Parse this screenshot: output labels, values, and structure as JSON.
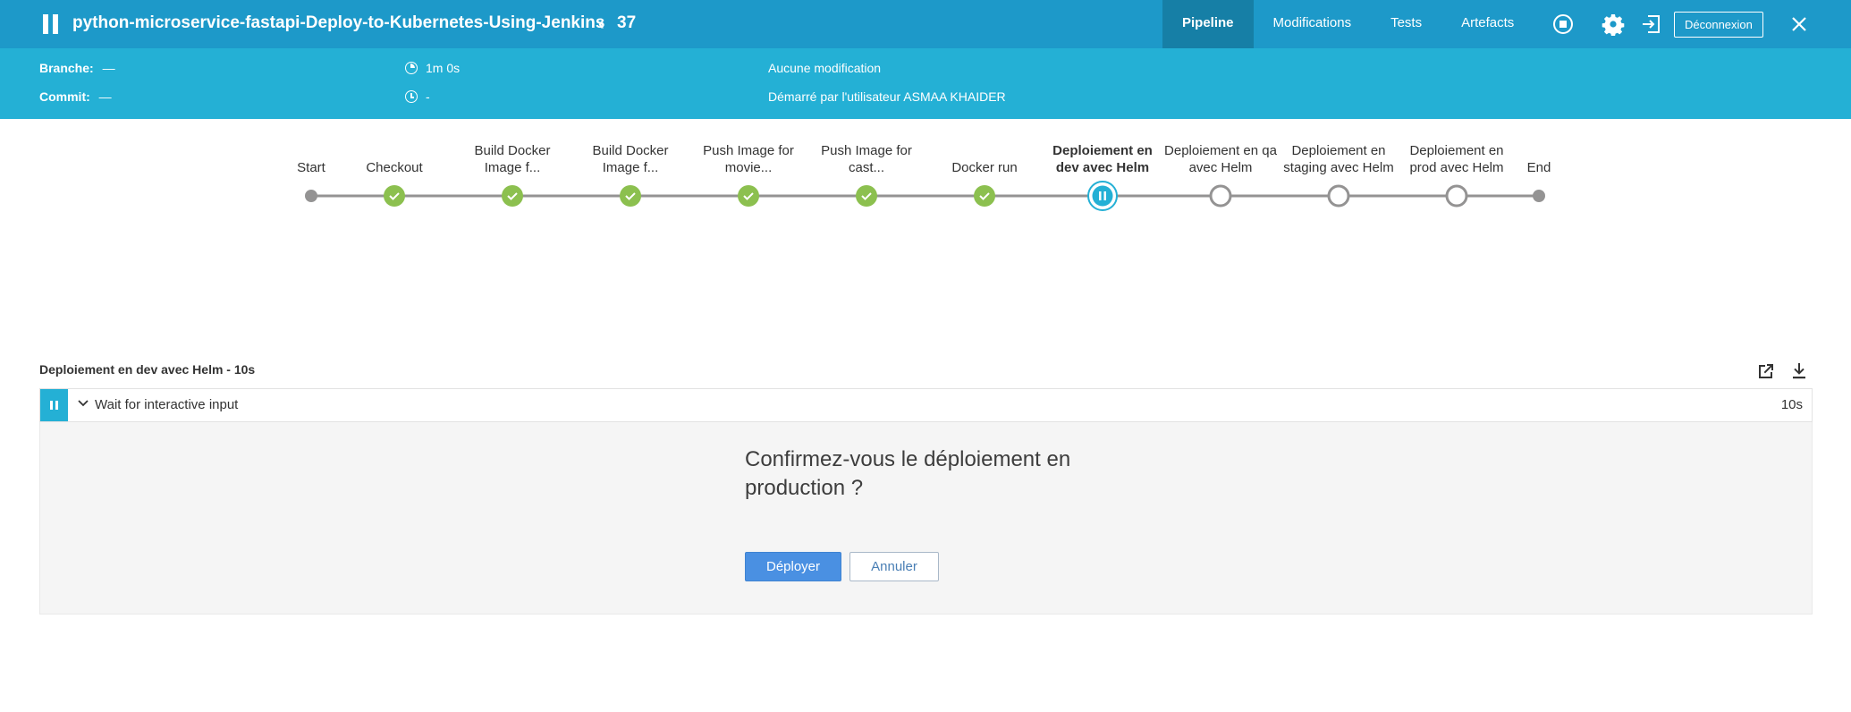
{
  "header": {
    "job_title": "python-microservice-fastapi-Deploy-to-Kubernetes-Using-Jenkins",
    "run_number": "37",
    "tabs": [
      {
        "label": "Pipeline",
        "active": true
      },
      {
        "label": "Modifications",
        "active": false
      },
      {
        "label": "Tests",
        "active": false
      },
      {
        "label": "Artefacts",
        "active": false
      }
    ],
    "logout_label": "Déconnexion"
  },
  "info": {
    "branch_label": "Branche:",
    "branch_value": "—",
    "commit_label": "Commit:",
    "commit_value": "—",
    "duration": "1m 0s",
    "started": "-",
    "changes": "Aucune modification",
    "started_by": "Démarré par l'utilisateur ASMAA KHAIDER"
  },
  "pipeline": {
    "stages": [
      {
        "label": "Start",
        "status": "start"
      },
      {
        "label": "Checkout",
        "status": "success"
      },
      {
        "label": "Build Docker Image f...",
        "status": "success"
      },
      {
        "label": "Build Docker Image f...",
        "status": "success"
      },
      {
        "label": "Push Image for movie...",
        "status": "success"
      },
      {
        "label": "Push Image for cast...",
        "status": "success"
      },
      {
        "label": "Docker run",
        "status": "success"
      },
      {
        "label": "Deploiement en dev avec Helm",
        "status": "paused"
      },
      {
        "label": "Deploiement en qa avec Helm",
        "status": "not_built"
      },
      {
        "label": "Deploiement en staging avec Helm",
        "status": "not_built"
      },
      {
        "label": "Deploiement en prod avec Helm",
        "status": "not_built"
      },
      {
        "label": "End",
        "status": "end"
      }
    ]
  },
  "step_panel": {
    "title": "Deploiement en dev avec Helm - 10s",
    "step_name": "Wait for interactive input",
    "step_duration": "10s",
    "question": "Confirmez-vous le déploiement en production ?",
    "proceed_label": "Déployer",
    "abort_label": "Annuler"
  },
  "colors": {
    "header_bg": "#1d99c9",
    "infobar_bg": "#24b0d5",
    "success": "#8cc04f",
    "paused": "#24b0d5",
    "primary_button": "#4a90e2"
  }
}
